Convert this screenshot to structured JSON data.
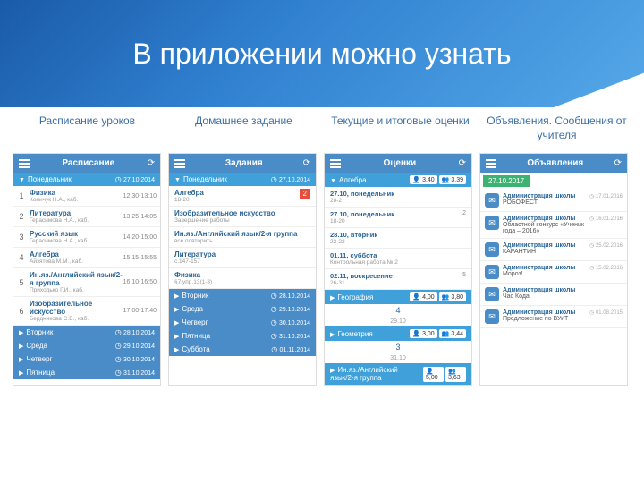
{
  "title": "В приложении можно узнать",
  "captions": [
    "Расписание уроков",
    "Домашнее задание",
    "Текущие и итоговые оценки",
    "Объявления. Сообщения от учителя"
  ],
  "schedule": {
    "header": "Расписание",
    "action": "⟳",
    "day": "Понедельник",
    "day_date": "27.10.2014",
    "lessons": [
      {
        "n": "1",
        "subj": "Физика",
        "sub": "Коничук Н.А., каб.",
        "time": "12:30-13:10"
      },
      {
        "n": "2",
        "subj": "Литература",
        "sub": "Герасимова Н.А., каб.",
        "time": "13:25-14:05"
      },
      {
        "n": "3",
        "subj": "Русский язык",
        "sub": "Герасимова Н.А., каб.",
        "time": "14:20-15:00"
      },
      {
        "n": "4",
        "subj": "Алгебра",
        "sub": "Айзятова М.М., каб.",
        "time": "15:15-15:55"
      },
      {
        "n": "5",
        "subj": "Ин.яз./Английский язык/2-я группа",
        "sub": "Приходько Г.И., каб.",
        "time": "16:10-16:50"
      },
      {
        "n": "6",
        "subj": "Изобразительное искусство",
        "sub": "Бердникова С.В., каб.",
        "time": "17:00-17:40"
      }
    ],
    "collapsed": [
      {
        "d": "Вторник",
        "date": "28.10.2014"
      },
      {
        "d": "Среда",
        "date": "29.10.2014"
      },
      {
        "d": "Четверг",
        "date": "30.10.2014"
      },
      {
        "d": "Пятница",
        "date": "31.10.2014"
      }
    ]
  },
  "homework": {
    "header": "Задания",
    "action": "⟳",
    "day": "Понедельник",
    "day_date": "27.10.2014",
    "items": [
      {
        "subj": "Алгебра",
        "sub": "18-20",
        "badge": "2"
      },
      {
        "subj": "Изобразительное искусство",
        "sub": "Завершение работы"
      },
      {
        "subj": "Ин.яз./Английский язык/2-я группа",
        "sub": "все повторить"
      },
      {
        "subj": "Литература",
        "sub": "с.147-157"
      },
      {
        "subj": "Физика",
        "sub": "§7,упр.13(1-3)"
      }
    ],
    "collapsed": [
      {
        "d": "Вторник",
        "date": "28.10.2014"
      },
      {
        "d": "Среда",
        "date": "29.10.2014"
      },
      {
        "d": "Четверг",
        "date": "30.10.2014"
      },
      {
        "d": "Пятница",
        "date": "31.10.2014"
      },
      {
        "d": "Суббота",
        "date": "01.11.2014"
      }
    ]
  },
  "grades": {
    "header": "Оценки",
    "action": "⟳",
    "subjects": [
      {
        "name": "Алгебра",
        "p1": "👤 3,40",
        "p2": "👥 3,39",
        "rows": [
          {
            "date": "27.10, понедельник",
            "desc": "28-2",
            "val": ""
          },
          {
            "date": "27.10, понедельник",
            "desc": "18-20",
            "val": "2"
          },
          {
            "date": "28.10, вторник",
            "desc": "22-22",
            "val": ""
          },
          {
            "date": "01.11, суббота",
            "desc": "Контрольная работа № 2",
            "val": ""
          },
          {
            "date": "02.11, воскресение",
            "desc": "26-31",
            "val": "5"
          }
        ]
      },
      {
        "name": "География",
        "p1": "👤 4,00",
        "p2": "👥 3,80",
        "g": "4",
        "gd": "29.10"
      },
      {
        "name": "Геометрия",
        "p1": "👤 3,00",
        "p2": "👥 3,44",
        "g": "3",
        "gd": "31.10"
      },
      {
        "name": "Ин.яз./Английский язык/2-я группа",
        "p1": "👤 5,00",
        "p2": "👥 3,63"
      }
    ]
  },
  "announcements": {
    "header": "Объявления",
    "action": "⟳",
    "stamp": "27.10.2017",
    "items": [
      {
        "from": "Администрация школы",
        "text": "РОБОФЕСТ",
        "date": "◷ 17.01.2016"
      },
      {
        "from": "Администрация школы",
        "text": "Областной конкурс «Ученик года – 2016»",
        "date": "◷ 16.01.2016"
      },
      {
        "from": "Администрация школы",
        "text": "КАРАНТИН",
        "date": "◷ 25.02.2016"
      },
      {
        "from": "Администрация школы",
        "text": "Мороз!",
        "date": "◷ 15.02.2016"
      },
      {
        "from": "Администрация школы",
        "text": "Час Кода",
        "date": ""
      },
      {
        "from": "Администрация школы",
        "text": "Предложение по ВУиТ",
        "date": "◷ 01.08.2015"
      }
    ]
  }
}
